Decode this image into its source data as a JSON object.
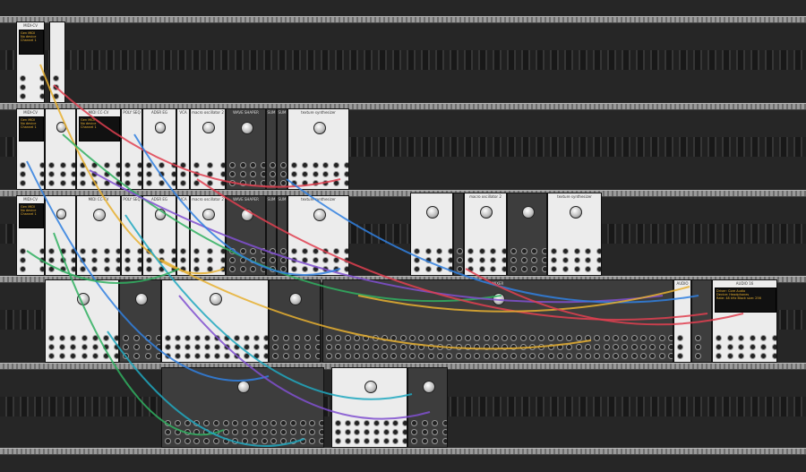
{
  "app": "VCV Rack",
  "modules": [
    {
      "label": "MIDI-CV",
      "theme": "light",
      "screen": [
        "Gen MIDI",
        "No device",
        "Channel 1"
      ]
    },
    {
      "label": "",
      "theme": "light"
    },
    {
      "label": "MIDI-CV",
      "theme": "light",
      "screen": [
        "Gen MIDI",
        "No device",
        "Channel 1"
      ]
    },
    {
      "label": "",
      "theme": "light"
    },
    {
      "label": "MIDI CC-CV",
      "theme": "light",
      "screen": [
        "Gen MIDI",
        "No device",
        "Channel 1"
      ]
    },
    {
      "label": "POLY SEQ",
      "theme": "light"
    },
    {
      "label": "ADSR EG",
      "theme": "light"
    },
    {
      "label": "VCA",
      "theme": "light"
    },
    {
      "label": "macro oscillator 2",
      "theme": "light"
    },
    {
      "label": "WAVE SHAPER",
      "theme": "dark"
    },
    {
      "label": "SUM",
      "theme": "dark"
    },
    {
      "label": "SUM",
      "theme": "dark"
    },
    {
      "label": "texture synthesizer",
      "theme": "light"
    },
    {
      "label": "MIDI-CV",
      "theme": "light",
      "screen": [
        "Gen MIDI",
        "No device",
        "Channel 1"
      ]
    },
    {
      "label": "",
      "theme": "light"
    },
    {
      "label": "MIDI CC-CV",
      "theme": "light"
    },
    {
      "label": "POLY SEQ",
      "theme": "light"
    },
    {
      "label": "ADSR EG",
      "theme": "light"
    },
    {
      "label": "VCA",
      "theme": "light"
    },
    {
      "label": "macro oscillator 2",
      "theme": "light"
    },
    {
      "label": "WAVE SHAPER",
      "theme": "dark"
    },
    {
      "label": "SUM",
      "theme": "dark"
    },
    {
      "label": "SUM",
      "theme": "dark"
    },
    {
      "label": "texture synthesizer",
      "theme": "light"
    },
    {
      "label": "",
      "theme": "light"
    },
    {
      "label": "",
      "theme": "dark"
    },
    {
      "label": "macro oscillator 2",
      "theme": "light"
    },
    {
      "label": "",
      "theme": "dark"
    },
    {
      "label": "texture synthesizer",
      "theme": "light"
    },
    {
      "label": "",
      "theme": "light"
    },
    {
      "label": "",
      "theme": "dark"
    },
    {
      "label": "",
      "theme": "light"
    },
    {
      "label": "",
      "theme": "dark"
    },
    {
      "label": "MIXER",
      "theme": "dark"
    },
    {
      "label": "AUDIO",
      "theme": "light"
    },
    {
      "label": "",
      "theme": "dark"
    },
    {
      "label": "AUDIO 16",
      "theme": "light",
      "screen": [
        "Driver: Core Audio",
        "Device: Headphones",
        "Rate: 48 kHz   Block size: 256"
      ]
    },
    {
      "label": "",
      "theme": "dark"
    },
    {
      "label": "",
      "theme": "light"
    },
    {
      "label": "",
      "theme": "dark"
    }
  ],
  "cable_colors": [
    "#e8b030",
    "#e04050",
    "#30b060",
    "#3080e0",
    "#8050d0",
    "#20a8c0"
  ]
}
